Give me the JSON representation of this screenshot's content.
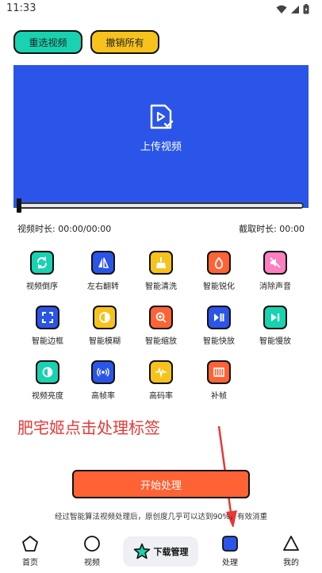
{
  "status_bar": {
    "time": "11:33"
  },
  "toolbar": {
    "reselect_label": "重选视频",
    "reselect_color": "#18d2b0",
    "undo_label": "撤销所有",
    "undo_color": "#f7c21c"
  },
  "preview": {
    "upload_label": "上传视频",
    "background_color": "#2b55e8"
  },
  "timeline": {
    "video_duration": "视频时长: 00:00/00:00",
    "clip_duration": "截取时长: 00:00",
    "position": 0
  },
  "tools": [
    {
      "label": "视频倒序",
      "icon": "refresh-icon",
      "color": "#18d2b0"
    },
    {
      "label": "左右翻转",
      "icon": "mirror-flip-icon",
      "color": "#2b55e8"
    },
    {
      "label": "智能清洗",
      "icon": "broom-icon",
      "color": "#f7c21c"
    },
    {
      "label": "智能锐化",
      "icon": "droplet-icon",
      "color": "#ff6235"
    },
    {
      "label": "消除声音",
      "icon": "mute-icon",
      "color": "#ff7fc0"
    },
    {
      "label": "智能边框",
      "icon": "frame-corners-icon",
      "color": "#2b55e8"
    },
    {
      "label": "智能模糊",
      "icon": "half-circle-icon",
      "color": "#f7c21c"
    },
    {
      "label": "智能缩放",
      "icon": "zoom-icon",
      "color": "#ff6235"
    },
    {
      "label": "智能快放",
      "icon": "play-pause-icon",
      "color": "#2b55e8"
    },
    {
      "label": "智能慢放",
      "icon": "skip-next-icon",
      "color": "#18d2b0"
    },
    {
      "label": "视频亮度",
      "icon": "brightness-icon",
      "color": "#18d2b0"
    },
    {
      "label": "高帧率",
      "icon": "broadcast-icon",
      "color": "#2b55e8"
    },
    {
      "label": "高码率",
      "icon": "waveform-icon",
      "color": "#f7c21c"
    },
    {
      "label": "补帧",
      "icon": "film-frames-icon",
      "color": "#ff6235"
    }
  ],
  "annotation": {
    "text": "肥宅姬点击处理标签"
  },
  "start_button": {
    "label": "开始处理"
  },
  "note": {
    "text": "经过智能算法视频处理后，原创度几乎可以达到90%，有效消重"
  },
  "bottom_nav": [
    {
      "label": "首页",
      "icon": "pentagon-icon"
    },
    {
      "label": "视频",
      "icon": "circle-icon"
    },
    {
      "label": "下载管理",
      "icon": "star-icon"
    },
    {
      "label": "处理",
      "icon": "square-icon"
    },
    {
      "label": "我的",
      "icon": "triangle-icon"
    }
  ]
}
